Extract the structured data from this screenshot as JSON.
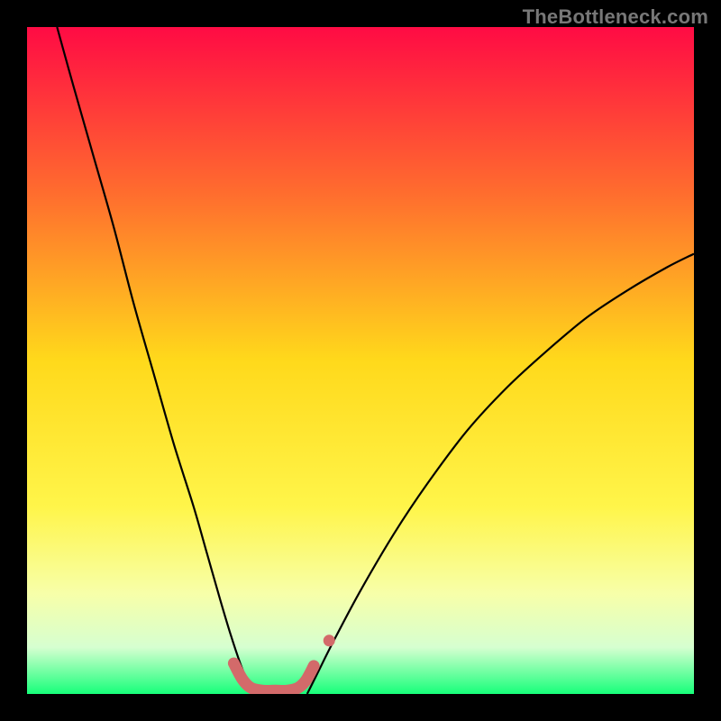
{
  "watermark": "TheBottleneck.com",
  "chart_data": {
    "type": "line",
    "title": "",
    "xlabel": "",
    "ylabel": "",
    "xlim": [
      0,
      100
    ],
    "ylim": [
      0,
      100
    ],
    "grid": false,
    "legend": false,
    "background_gradient_stops": [
      {
        "offset": 0,
        "color": "#ff0b44"
      },
      {
        "offset": 25,
        "color": "#ff6d2e"
      },
      {
        "offset": 50,
        "color": "#ffd91b"
      },
      {
        "offset": 72,
        "color": "#fff54a"
      },
      {
        "offset": 85,
        "color": "#f7ffa9"
      },
      {
        "offset": 93,
        "color": "#d6ffd0"
      },
      {
        "offset": 100,
        "color": "#17ff7a"
      }
    ],
    "series": [
      {
        "name": "left-curve",
        "stroke": "#000000",
        "width": 2.2,
        "points": [
          {
            "x": 4.5,
            "y": 100.0
          },
          {
            "x": 7.0,
            "y": 91.0
          },
          {
            "x": 10.0,
            "y": 80.5
          },
          {
            "x": 13.0,
            "y": 70.0
          },
          {
            "x": 16.0,
            "y": 58.5
          },
          {
            "x": 19.0,
            "y": 48.0
          },
          {
            "x": 22.0,
            "y": 37.5
          },
          {
            "x": 25.0,
            "y": 28.0
          },
          {
            "x": 27.0,
            "y": 21.0
          },
          {
            "x": 29.0,
            "y": 14.0
          },
          {
            "x": 30.5,
            "y": 9.0
          },
          {
            "x": 32.0,
            "y": 4.5
          },
          {
            "x": 33.0,
            "y": 2.0
          },
          {
            "x": 34.0,
            "y": 0.0
          }
        ]
      },
      {
        "name": "right-curve",
        "stroke": "#000000",
        "width": 2.2,
        "points": [
          {
            "x": 42.0,
            "y": 0.0
          },
          {
            "x": 43.5,
            "y": 3.0
          },
          {
            "x": 46.0,
            "y": 8.0
          },
          {
            "x": 50.0,
            "y": 15.5
          },
          {
            "x": 55.0,
            "y": 24.0
          },
          {
            "x": 60.0,
            "y": 31.5
          },
          {
            "x": 66.0,
            "y": 39.5
          },
          {
            "x": 72.0,
            "y": 46.0
          },
          {
            "x": 78.0,
            "y": 51.5
          },
          {
            "x": 84.0,
            "y": 56.5
          },
          {
            "x": 90.0,
            "y": 60.5
          },
          {
            "x": 96.0,
            "y": 64.0
          },
          {
            "x": 100.0,
            "y": 66.0
          }
        ]
      },
      {
        "name": "valley-floor",
        "stroke": "#d36a6a",
        "width": 13,
        "linecap": "round",
        "points": [
          {
            "x": 31.0,
            "y": 4.6
          },
          {
            "x": 32.3,
            "y": 2.2
          },
          {
            "x": 33.6,
            "y": 0.9
          },
          {
            "x": 35.4,
            "y": 0.5
          },
          {
            "x": 37.2,
            "y": 0.5
          },
          {
            "x": 39.0,
            "y": 0.5
          },
          {
            "x": 40.6,
            "y": 0.9
          },
          {
            "x": 41.8,
            "y": 2.0
          },
          {
            "x": 43.0,
            "y": 4.2
          }
        ]
      },
      {
        "name": "accent-dot",
        "stroke": "#d36a6a",
        "width": 13,
        "linecap": "round",
        "points": [
          {
            "x": 45.3,
            "y": 8.0
          },
          {
            "x": 45.3,
            "y": 8.0
          }
        ]
      }
    ]
  }
}
